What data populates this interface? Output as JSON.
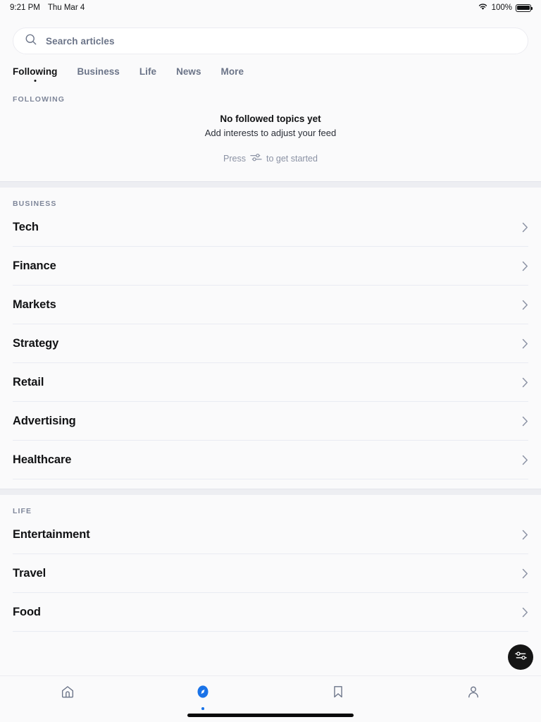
{
  "status_bar": {
    "time": "9:21 PM",
    "date": "Thu Mar 4",
    "battery_percent": "100%",
    "wifi_icon": "wifi-icon",
    "battery_icon": "battery-full-icon"
  },
  "search": {
    "placeholder": "Search articles",
    "icon": "search-icon",
    "value": ""
  },
  "tabs": [
    {
      "label": "Following",
      "active": true
    },
    {
      "label": "Business",
      "active": false
    },
    {
      "label": "Life",
      "active": false
    },
    {
      "label": "News",
      "active": false
    },
    {
      "label": "More",
      "active": false
    }
  ],
  "following_section": {
    "header": "FOLLOWING",
    "empty_title": "No followed topics yet",
    "empty_subtitle": "Add interests to adjust your feed",
    "hint_prefix": "Press",
    "hint_icon": "sliders-icon",
    "hint_suffix": "to get started"
  },
  "business_section": {
    "header": "BUSINESS",
    "rows": [
      {
        "label": "Tech",
        "chevron": "chevron-right-icon"
      },
      {
        "label": "Finance",
        "chevron": "chevron-right-icon"
      },
      {
        "label": "Markets",
        "chevron": "chevron-right-icon"
      },
      {
        "label": "Strategy",
        "chevron": "chevron-right-icon"
      },
      {
        "label": "Retail",
        "chevron": "chevron-right-icon"
      },
      {
        "label": "Advertising",
        "chevron": "chevron-right-icon"
      },
      {
        "label": "Healthcare",
        "chevron": "chevron-right-icon"
      }
    ]
  },
  "life_section": {
    "header": "LIFE",
    "rows": [
      {
        "label": "Entertainment",
        "chevron": "chevron-right-icon"
      },
      {
        "label": "Travel",
        "chevron": "chevron-right-icon"
      },
      {
        "label": "Food",
        "chevron": "chevron-right-icon"
      }
    ]
  },
  "fab": {
    "icon": "sliders-icon"
  },
  "bottom_nav": [
    {
      "icon": "home-icon",
      "active": false
    },
    {
      "icon": "compass-icon",
      "active": true
    },
    {
      "icon": "bookmark-icon",
      "active": false
    },
    {
      "icon": "person-icon",
      "active": false
    }
  ],
  "colors": {
    "accent": "#1a73e8",
    "text_primary": "#111214",
    "text_muted": "#6b7488",
    "background": "#fafafb",
    "fab_background": "#151515",
    "divider": "#e9ebf2"
  }
}
